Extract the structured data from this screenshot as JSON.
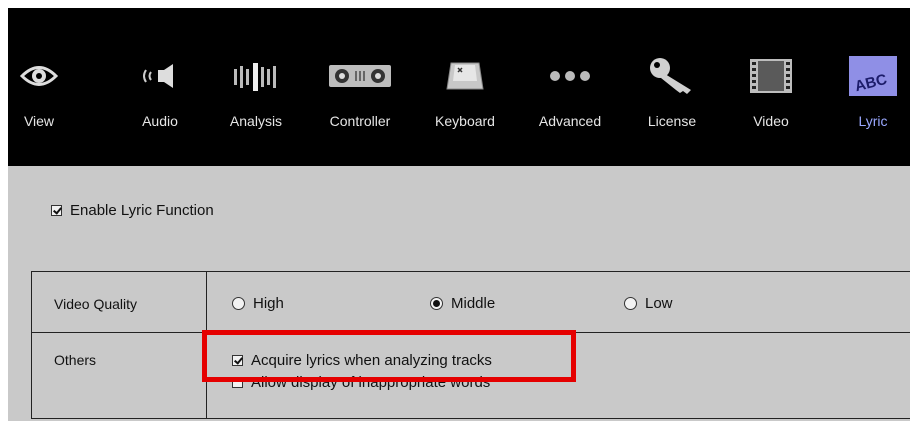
{
  "toolbar": {
    "items": [
      {
        "label": "View",
        "icon": "eye-icon"
      },
      {
        "label": "Audio",
        "icon": "speaker-icon"
      },
      {
        "label": "Analysis",
        "icon": "waveform-bars-icon"
      },
      {
        "label": "Controller",
        "icon": "controller-icon"
      },
      {
        "label": "Keyboard",
        "icon": "key-icon"
      },
      {
        "label": "Advanced",
        "icon": "dots-icon"
      },
      {
        "label": "License",
        "icon": "license-key-icon"
      },
      {
        "label": "Video",
        "icon": "film-icon"
      },
      {
        "label": "Lyric",
        "icon": "abc-icon",
        "icon_text": "ABC"
      }
    ],
    "active": "Lyric",
    "active_color": "#9aa8ff"
  },
  "lyric": {
    "enable_label": "Enable Lyric Function",
    "enable_checked": true,
    "video_quality": {
      "label": "Video Quality",
      "options": [
        "High",
        "Middle",
        "Low"
      ],
      "selected": "Middle"
    },
    "others": {
      "label": "Others",
      "acquire_label": "Acquire lyrics when analyzing tracks",
      "acquire_checked": true,
      "inappropriate_label": "Allow display of inappropriate words",
      "inappropriate_checked": false
    }
  },
  "highlight_color": "#e50000"
}
